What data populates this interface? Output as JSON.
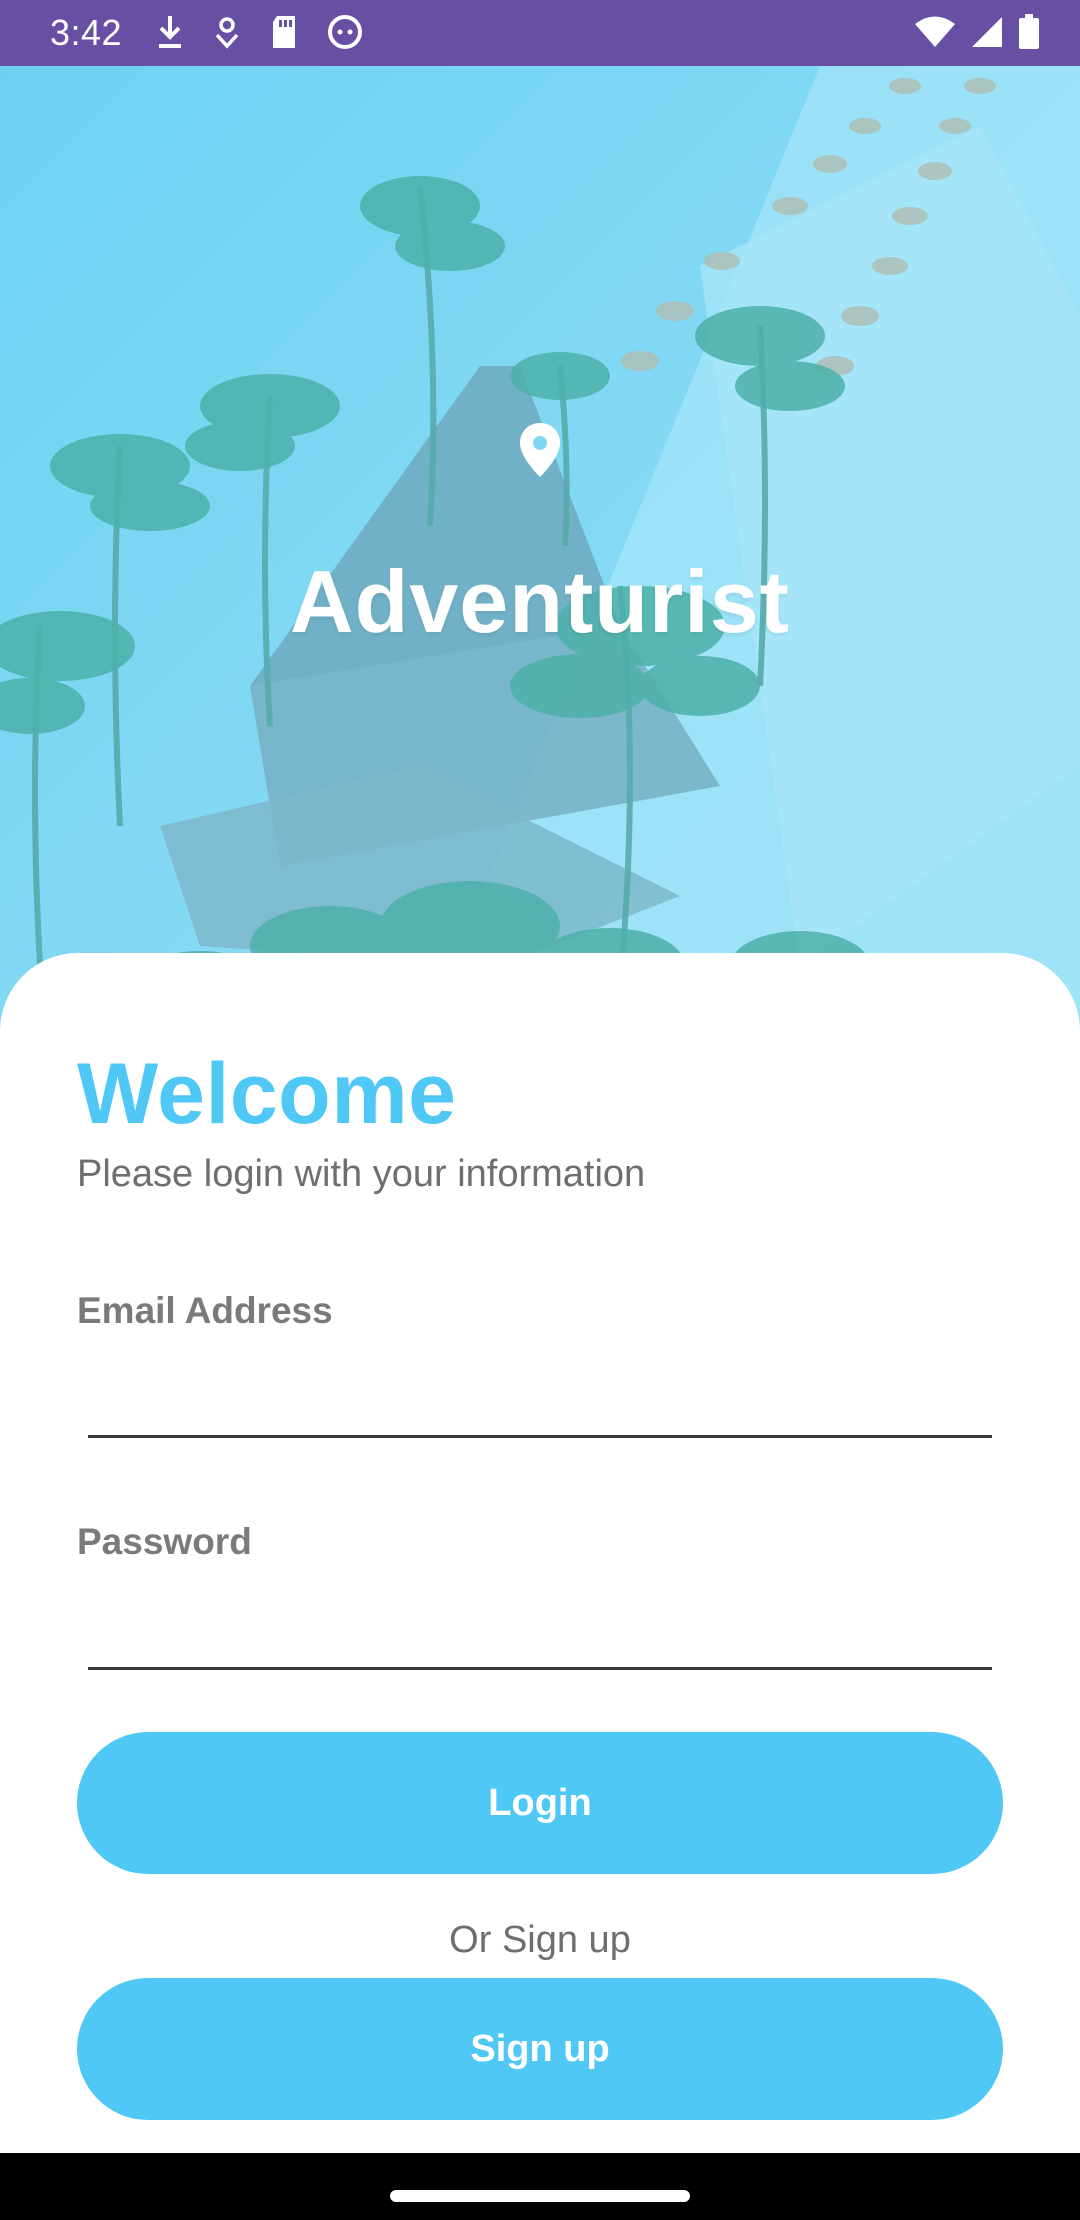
{
  "status_bar": {
    "time": "3:42",
    "left_icons": [
      "download-icon",
      "location-ring-icon",
      "sd-card-icon",
      "android-face-icon"
    ],
    "right_icons": [
      "wifi-icon",
      "signal-icon",
      "battery-icon"
    ],
    "background": "#6750A4"
  },
  "hero": {
    "app_name": "Adventurist",
    "icon": "map-pin-icon"
  },
  "login": {
    "welcome": "Welcome",
    "subtitle": "Please login with your information",
    "email_label": "Email Address",
    "email_value": "",
    "password_label": "Password",
    "password_value": "",
    "login_button": "Login",
    "or_text": "Or Sign up",
    "signup_button": "Sign up"
  },
  "colors": {
    "accent": "#4FC8F5",
    "status_bar": "#6750A4",
    "label_gray": "#7A7A7A"
  }
}
